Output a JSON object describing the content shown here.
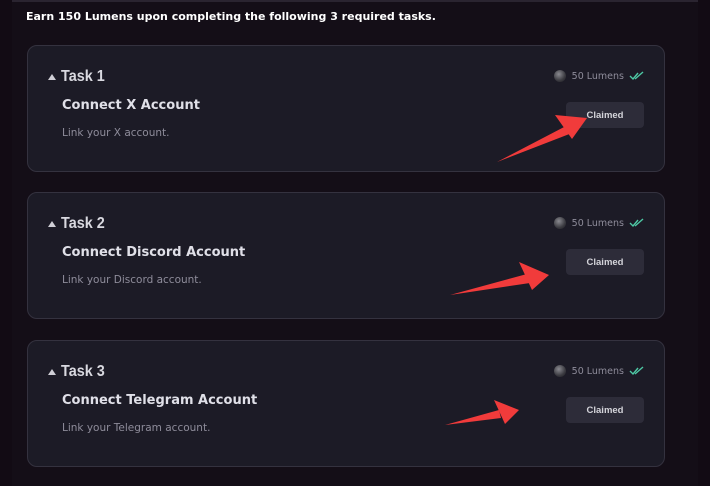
{
  "intro_text": "Earn 150 Lumens upon completing the following 3 required tasks.",
  "colors": {
    "background": "#120b14",
    "card": "#1c1b26",
    "check": "#4ec9a5",
    "arrow": "#f13b3b"
  },
  "tasks": [
    {
      "label": "Task 1",
      "title": "Connect X Account",
      "description": "Link your X account.",
      "reward": "50 Lumens",
      "button": "Claimed",
      "completed": true
    },
    {
      "label": "Task 2",
      "title": "Connect Discord Account",
      "description": "Link your Discord account.",
      "reward": "50 Lumens",
      "button": "Claimed",
      "completed": true
    },
    {
      "label": "Task 3",
      "title": "Connect Telegram Account",
      "description": "Link your Telegram account.",
      "reward": "50 Lumens",
      "button": "Claimed",
      "completed": true
    }
  ]
}
